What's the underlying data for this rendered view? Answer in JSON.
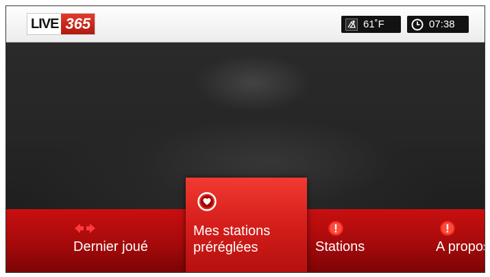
{
  "header": {
    "logo": {
      "live": "LIVE",
      "number": "365"
    },
    "weather": {
      "icon": "weather-icon",
      "temperature": "61˚F"
    },
    "clock": {
      "icon": "clock-icon",
      "time": "07:38"
    }
  },
  "menu": {
    "items": [
      {
        "id": "recent",
        "icon": "arrows-left-right-icon",
        "label": "Dernier joué",
        "selected": false
      },
      {
        "id": "presets",
        "icon": "heart-icon",
        "label": "Mes stations préréglées",
        "selected": true
      },
      {
        "id": "stations",
        "icon": "info-icon",
        "label": "Stations",
        "selected": false
      },
      {
        "id": "about",
        "icon": "info-icon",
        "label": "A propos",
        "selected": false
      }
    ]
  },
  "colors": {
    "accent": "#d7201c",
    "menu_bar": "#a50a0b",
    "status_bg": "#121212"
  }
}
